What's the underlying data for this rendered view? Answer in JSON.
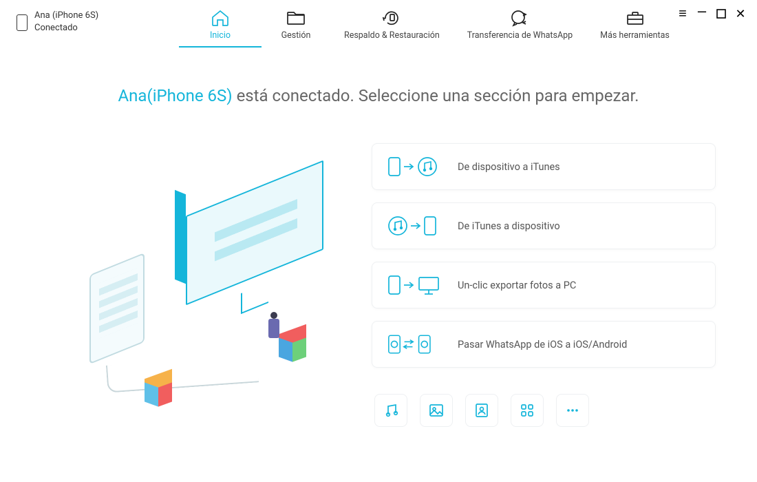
{
  "device": {
    "name": "Ana (iPhone 6S)",
    "status": "Conectado",
    "short": "Ana(iPhone 6S)"
  },
  "nav": {
    "home": "Inicio",
    "manage": "Gestión",
    "backup": "Respaldo & Restauración",
    "whatsapp": "Transferencia de WhatsApp",
    "tools": "Más herramientas"
  },
  "hero": {
    "suffix": " está conectado. Seleccione una sección para empezar."
  },
  "cards": {
    "toItunes": "De dispositivo a iTunes",
    "fromItunes": "De iTunes a dispositivo",
    "photosPc": "Un-clic exportar fotos a PC",
    "whatsapp": "Pasar WhatsApp de iOS a iOS/Android"
  },
  "quick": {
    "music": "music",
    "photos": "photos",
    "contacts": "contacts",
    "apps": "apps",
    "more": "more"
  },
  "colors": {
    "accent": "#14b5da"
  }
}
